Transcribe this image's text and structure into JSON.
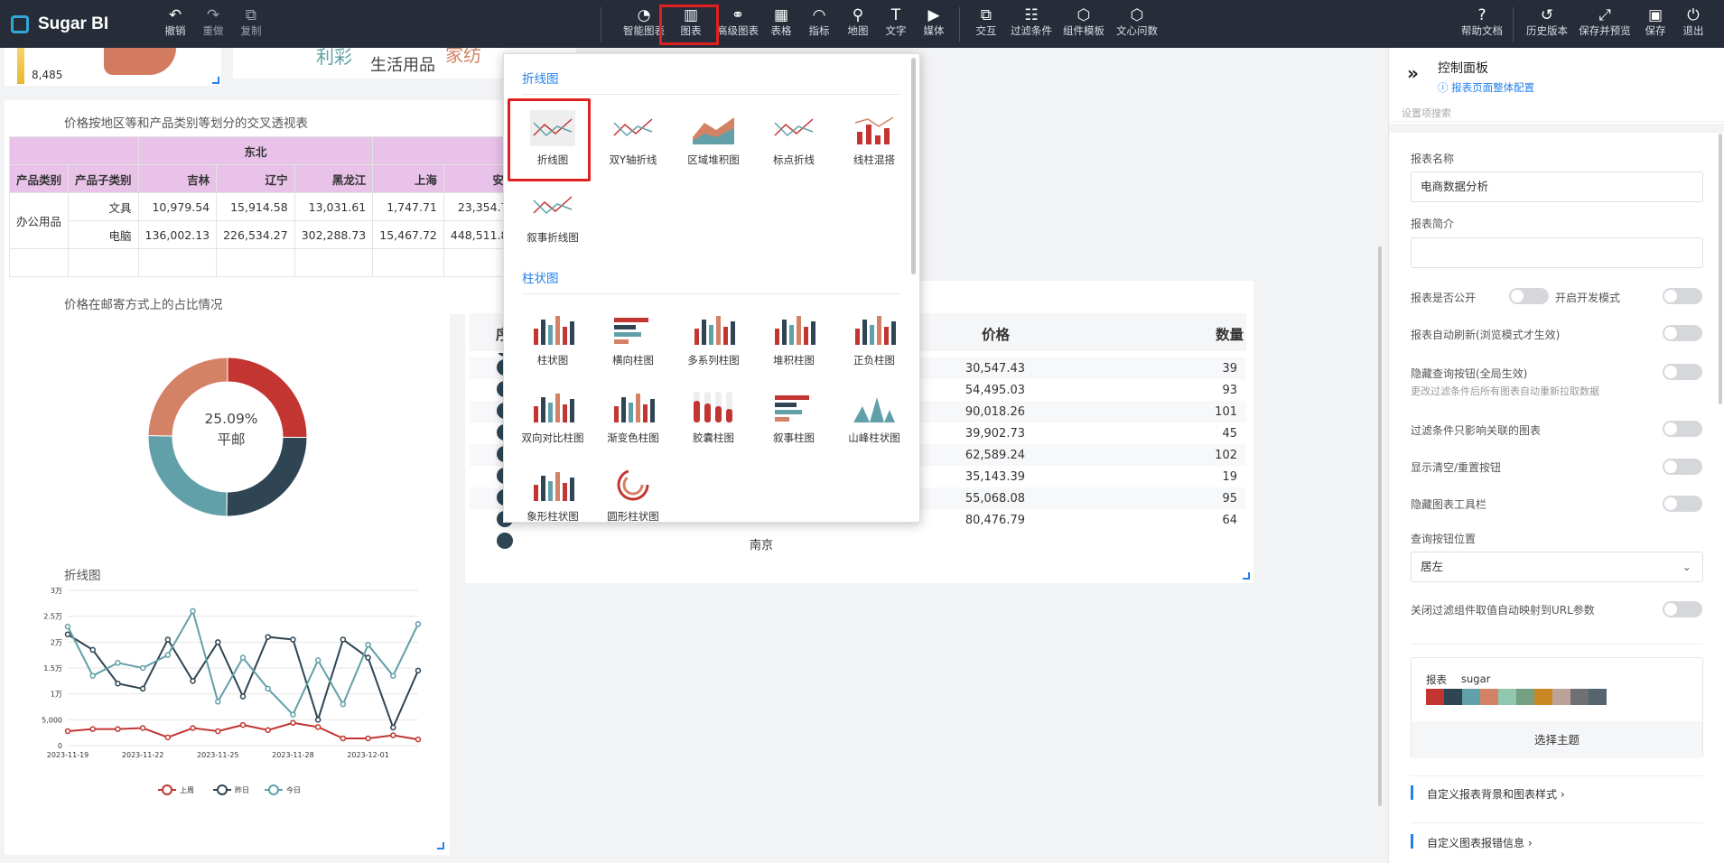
{
  "app": {
    "name": "Sugar BI"
  },
  "toolbar": {
    "left": [
      {
        "id": "undo",
        "label": "撤销",
        "icon": "↶"
      },
      {
        "id": "redo",
        "label": "重做",
        "icon": "↷"
      },
      {
        "id": "copy",
        "label": "复制",
        "icon": "⧉"
      }
    ],
    "center": [
      {
        "id": "smart",
        "label": "智能图表",
        "icon": "◔"
      },
      {
        "id": "chart",
        "label": "图表",
        "icon": "▥"
      },
      {
        "id": "advanced",
        "label": "高级图表",
        "icon": "⚭"
      },
      {
        "id": "table",
        "label": "表格",
        "icon": "▦"
      },
      {
        "id": "metric",
        "label": "指标",
        "icon": "◠"
      },
      {
        "id": "map",
        "label": "地图",
        "icon": "⚲"
      },
      {
        "id": "text",
        "label": "文字",
        "icon": "T"
      },
      {
        "id": "media",
        "label": "媒体",
        "icon": "▶"
      },
      {
        "id": "interaction",
        "label": "交互",
        "icon": "⧉"
      },
      {
        "id": "filter",
        "label": "过滤条件",
        "icon": "☷"
      },
      {
        "id": "template",
        "label": "组件模板",
        "icon": "⬡"
      },
      {
        "id": "wenxin",
        "label": "文心问数",
        "icon": "⬡"
      }
    ],
    "right": [
      {
        "id": "help",
        "label": "帮助文档",
        "icon": "?"
      },
      {
        "id": "history",
        "label": "历史版本",
        "icon": "↺"
      },
      {
        "id": "save-preview",
        "label": "保存并预览",
        "icon": "⤢"
      },
      {
        "id": "save",
        "label": "保存",
        "icon": "▣"
      },
      {
        "id": "exit",
        "label": "退出",
        "icon": "⏻"
      }
    ]
  },
  "cards": {
    "map_legend_value": "8,485",
    "wordcloud_words": [
      "利彩",
      "生活用品",
      "家纺"
    ],
    "pivot": {
      "title": "价格按地区等和产品类别等划分的交叉透视表",
      "region": "东北",
      "headers": [
        "产品类别",
        "产品子类别",
        "吉林",
        "辽宁",
        "黑龙江",
        "上海",
        "安徽"
      ],
      "category": "办公用品",
      "rows": [
        [
          "文具",
          "10,979.54",
          "15,914.58",
          "13,031.61",
          "1,747.71",
          "23,354.79"
        ],
        [
          "电脑",
          "136,002.13",
          "226,534.27",
          "302,288.73",
          "15,467.72",
          "448,511.87"
        ]
      ]
    },
    "donut": {
      "title": "价格在邮寄方式上的占比情况",
      "center_value": "25.09%",
      "center_label": "平邮",
      "colors": [
        "#c23531",
        "#2f4554",
        "#61a0a8",
        "#d48265"
      ]
    },
    "table": {
      "col_price": "价格",
      "col_qty": "数量",
      "col_seq": "序",
      "partial_city": "南京",
      "rows": [
        [
          "30,547.43",
          "39"
        ],
        [
          "54,495.03",
          "93"
        ],
        [
          "90,018.26",
          "101"
        ],
        [
          "39,902.73",
          "45"
        ],
        [
          "62,589.24",
          "102"
        ],
        [
          "35,143.39",
          "19"
        ],
        [
          "55,068.08",
          "95"
        ],
        [
          "80,476.79",
          "64"
        ]
      ]
    },
    "line_title": "折线图"
  },
  "chart_data": {
    "type": "line",
    "title": "折线图",
    "x": [
      "2023-11-19",
      "2023-11-20",
      "2023-11-21",
      "2023-11-22",
      "2023-11-23",
      "2023-11-24",
      "2023-11-25",
      "2023-11-26",
      "2023-11-27",
      "2023-11-28",
      "2023-11-29",
      "2023-11-30",
      "2023-12-01",
      "2023-12-02",
      "2023-12-03"
    ],
    "x_tick_labels": [
      "2023-11-19",
      "2023-11-22",
      "2023-11-25",
      "2023-11-28",
      "2023-12-01"
    ],
    "y_tick_labels": [
      "0",
      "5,000",
      "1万",
      "1.5万",
      "2万",
      "2.5万",
      "3万"
    ],
    "ylim": [
      0,
      30000
    ],
    "grid": true,
    "legend_position": "bottom-center",
    "series": [
      {
        "name": "上周",
        "color": "#c23531",
        "values": [
          2800,
          3200,
          3200,
          3400,
          1600,
          3400,
          2800,
          4000,
          3000,
          4400,
          3600,
          1400,
          1400,
          2000,
          1200
        ]
      },
      {
        "name": "昨日",
        "color": "#2f4554",
        "values": [
          21500,
          18500,
          12000,
          11000,
          20500,
          12500,
          20000,
          9500,
          21000,
          20500,
          5000,
          20500,
          17000,
          3500,
          14500
        ]
      },
      {
        "name": "今日",
        "color": "#61a0a8",
        "values": [
          23000,
          13500,
          16000,
          15000,
          17500,
          26000,
          8500,
          17000,
          11000,
          6000,
          16500,
          8000,
          19500,
          13500,
          23500
        ]
      }
    ]
  },
  "dropdown": {
    "groups": [
      {
        "title": "折线图",
        "items": [
          "折线图",
          "双Y轴折线",
          "区域堆积图",
          "标点折线",
          "线柱混搭",
          "叙事折线图"
        ]
      },
      {
        "title": "柱状图",
        "items": [
          "柱状图",
          "横向柱图",
          "多系列柱图",
          "堆积柱图",
          "正负柱图",
          "双向对比柱图",
          "渐变色柱图",
          "胶囊柱图",
          "叙事柱图",
          "山峰柱状图",
          "象形柱状图",
          "圆形柱状图"
        ]
      }
    ]
  },
  "panel": {
    "title": "控制面板",
    "subtitle": "报表页面整体配置",
    "search_placeholder": "设置项搜索",
    "report_name_label": "报表名称",
    "report_name": "电商数据分析",
    "report_desc_label": "报表简介",
    "public_label": "报表是否公开",
    "dev_mode_label": "开启开发模式",
    "auto_refresh_label": "报表自动刷新(浏览模式才生效)",
    "hide_query_label": "隐藏查询按钮(全局生效)",
    "hide_query_hint": "更改过滤条件后所有图表自动重新拉取数据",
    "filter_related_label": "过滤条件只影响关联的图表",
    "show_reset_label": "显示清空/重置按钮",
    "hide_toolbar_label": "隐藏图表工具栏",
    "query_pos_label": "查询按钮位置",
    "query_pos_value": "居左",
    "close_url_label": "关闭过滤组件取值自动映射到URL参数",
    "theme_tag1": "报表",
    "theme_tag2": "sugar",
    "theme_colors": [
      "#c23531",
      "#2f4554",
      "#61a0a8",
      "#d48265",
      "#91c7ae",
      "#749f83",
      "#ca8622",
      "#bda29a",
      "#6e7074",
      "#546570"
    ],
    "choose_theme": "选择主题",
    "custom_bg": "自定义报表背景和图表样式",
    "custom_err": "自定义图表报错信息"
  }
}
